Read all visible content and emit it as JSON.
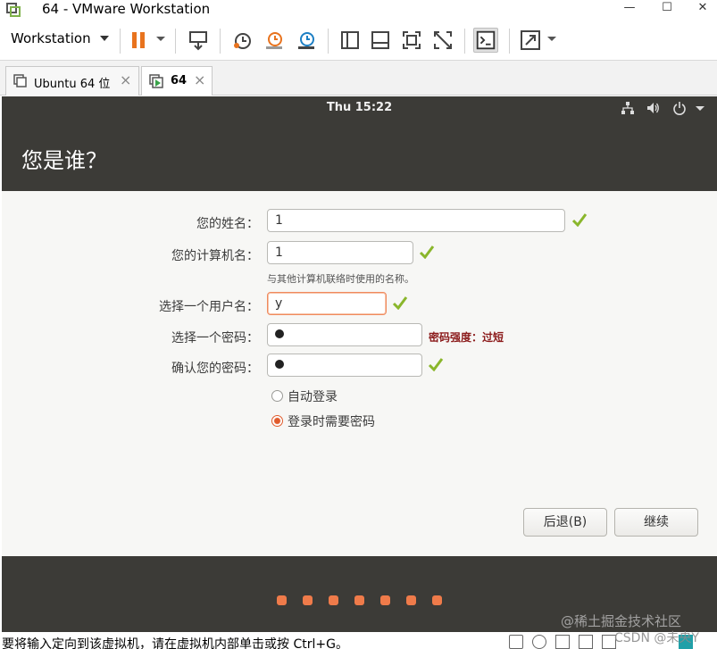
{
  "window": {
    "title": "64 - VMware Workstation"
  },
  "toolbar": {
    "menu_label": "Workstation"
  },
  "tabs": [
    {
      "label": "Ubuntu 64 位",
      "close": "×"
    },
    {
      "label": "64",
      "close": "×"
    }
  ],
  "guest": {
    "clock": "Thu 15:22",
    "page_title": "您是谁？",
    "form": {
      "name_label": "您的姓名：",
      "name_value": "1",
      "computer_label": "您的计算机名：",
      "computer_value": "1",
      "computer_hint": "与其他计算机联络时使用的名称。",
      "username_label": "选择一个用户名：",
      "username_value": "y",
      "password_label": "选择一个密码：",
      "password_strength": "密码强度：过短",
      "confirm_label": "确认您的密码："
    },
    "login_options": {
      "auto_login": "自动登录",
      "require_password": "登录时需要密码",
      "selected": "require_password"
    },
    "buttons": {
      "back": "后退(B)",
      "continue": "继续"
    },
    "progress": {
      "steps": 7
    }
  },
  "statusbar": {
    "message": "要将输入定向到该虚拟机，请在虚拟机内部单击或按 Ctrl+G。"
  },
  "watermarks": {
    "juejin": "@稀土掘金技术社区",
    "csdn": "CSDN @未央Y"
  },
  "colors": {
    "accent": "#E95420",
    "header_bg": "#3C3B37",
    "check": "#8AB62B",
    "strength": "#8B1A1A"
  }
}
